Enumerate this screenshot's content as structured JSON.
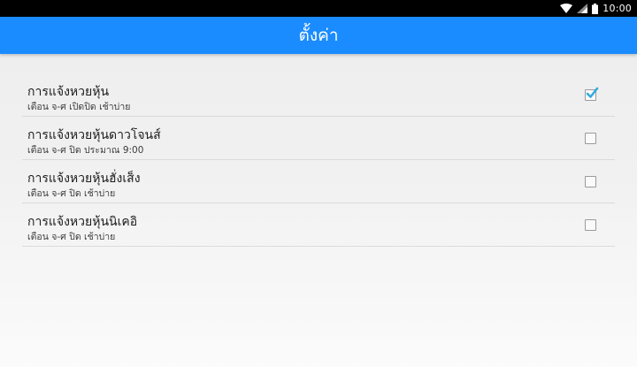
{
  "status_bar": {
    "time": "10:00",
    "icons": [
      "wifi-icon",
      "signal-icon",
      "battery-icon"
    ]
  },
  "app_bar": {
    "title": "ตั้งค่า",
    "color": "#1a8cff"
  },
  "settings": [
    {
      "title": "การแจ้งหวยหุ้น",
      "subtitle": "เตือน จ-ศ เปิดปิด เช้าบ่าย",
      "checked": true
    },
    {
      "title": "การแจ้งหวยหุ้นดาวโจนส์",
      "subtitle": "เตือน จ-ศ ปิด ประมาณ 9:00",
      "checked": false
    },
    {
      "title": "การแจ้งหวยหุ้นฮั่งเส็ง",
      "subtitle": "เตือน จ-ศ ปิด เช้าบ่าย",
      "checked": false
    },
    {
      "title": "การแจ้งหวยหุ้นนิเคอิ",
      "subtitle": "เตือน จ-ศ ปิด เช้าบ่าย",
      "checked": false
    }
  ],
  "accent_check_color": "#33aadd"
}
